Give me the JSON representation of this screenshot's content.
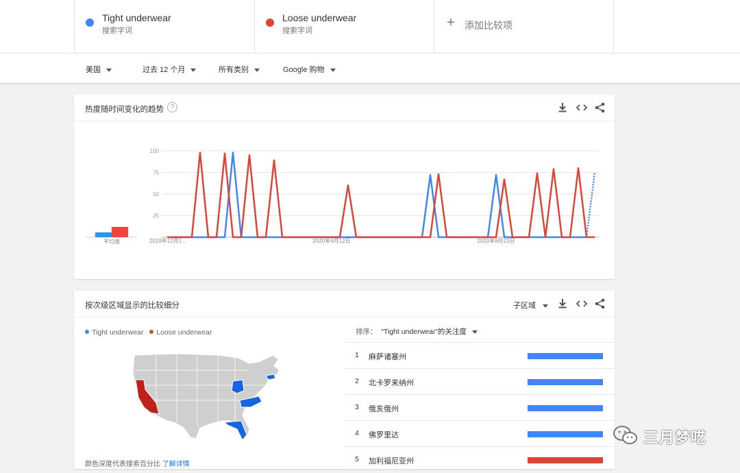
{
  "terms": [
    {
      "name": "Tight underwear",
      "sub": "搜索字词",
      "color": "#4285f4"
    },
    {
      "name": "Loose underwear",
      "sub": "搜索字词",
      "color": "#db4437"
    }
  ],
  "add_term": {
    "label": "添加比较项",
    "icon": "plus-icon"
  },
  "filters": {
    "region": "美国",
    "period": "过去 12 个月",
    "category": "所有类别",
    "property": "Google 购物"
  },
  "timeline": {
    "title": "热度随时间变化的趋势",
    "help": "?",
    "avg_label": "平均值",
    "icons": [
      "download-icon",
      "embed-icon",
      "share-icon"
    ]
  },
  "chart_data": {
    "type": "line",
    "yticks": [
      25,
      50,
      75,
      100
    ],
    "ylim": [
      0,
      100
    ],
    "xtick_labels": [
      "2019年12月1...",
      "2020年4月12日",
      "2020年8月23日"
    ],
    "xtick_weeks": [
      0,
      20,
      40
    ],
    "weeks": 53,
    "series": [
      {
        "name": "Tight underwear",
        "color": "#4285f4",
        "values": [
          0,
          0,
          0,
          0,
          0,
          0,
          0,
          0,
          98,
          0,
          0,
          0,
          0,
          0,
          0,
          0,
          0,
          0,
          0,
          0,
          0,
          0,
          0,
          0,
          0,
          0,
          0,
          0,
          0,
          0,
          0,
          0,
          72,
          0,
          0,
          0,
          0,
          0,
          0,
          0,
          72,
          0,
          0,
          0,
          0,
          0,
          0,
          0,
          0,
          0,
          0,
          0,
          75
        ],
        "partial_from": 51
      },
      {
        "name": "Loose underwear",
        "color": "#db4437",
        "values": [
          0,
          0,
          0,
          0,
          98,
          0,
          0,
          97,
          0,
          0,
          95,
          0,
          0,
          89,
          0,
          0,
          0,
          0,
          0,
          0,
          0,
          0,
          60,
          0,
          0,
          0,
          0,
          0,
          0,
          0,
          0,
          0,
          0,
          73,
          0,
          0,
          0,
          0,
          0,
          0,
          0,
          67,
          0,
          0,
          0,
          74,
          0,
          79,
          0,
          0,
          80,
          0,
          0
        ]
      }
    ],
    "averages": [
      {
        "name": "Tight underwear",
        "color": "#2196f3",
        "value": 7
      },
      {
        "name": "Loose underwear",
        "color": "#f44336",
        "value": 15
      }
    ]
  },
  "regions": {
    "title": "按次级区域显示的比较细分",
    "selector": "子区域",
    "sort_prefix": "排序：",
    "sort_value": "“Tight underwear”的关注度",
    "legend": [
      {
        "name": "Tight underwear",
        "color": "#4285f4"
      },
      {
        "name": "Loose underwear",
        "color": "#db4437"
      }
    ],
    "rows": [
      {
        "rank": "1",
        "name": "麻萨诸塞州",
        "color": "#4285f4",
        "share": 1.0
      },
      {
        "rank": "2",
        "name": "北卡罗来纳州",
        "color": "#4285f4",
        "share": 1.0
      },
      {
        "rank": "3",
        "name": "俄亥俄州",
        "color": "#4285f4",
        "share": 1.0
      },
      {
        "rank": "4",
        "name": "佛罗里达",
        "color": "#4285f4",
        "share": 1.0
      },
      {
        "rank": "5",
        "name": "加利福尼亚州",
        "color": "#db4437",
        "share": 1.0
      }
    ],
    "footer_text": "颜色深度代表搜索百分比",
    "footer_link": "了解详情"
  },
  "watermark": {
    "text": "三月梦呓",
    "icon": "wechat-icon"
  }
}
